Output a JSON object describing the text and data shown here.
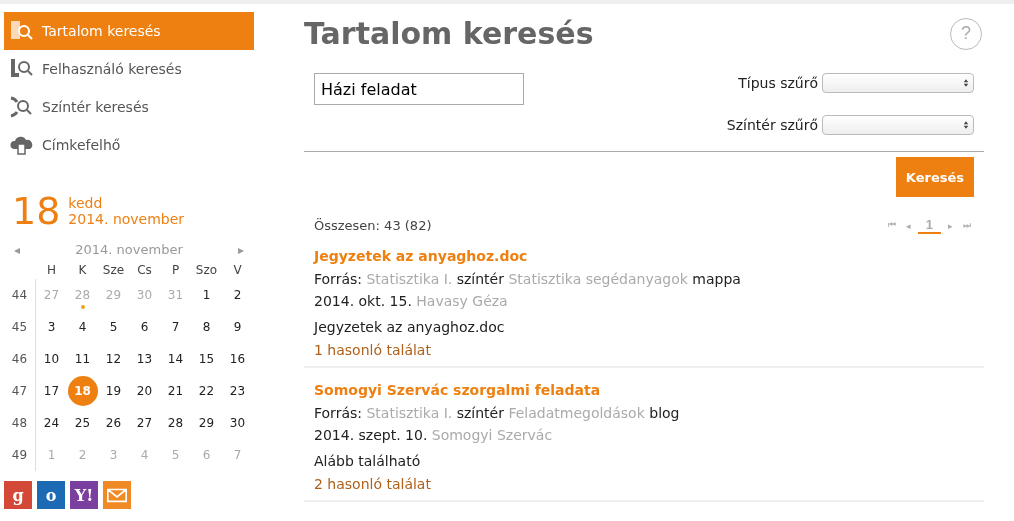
{
  "nav": [
    {
      "label": "Tartalom keresés",
      "kind": "content",
      "selected": true
    },
    {
      "label": "Felhasználó keresés",
      "kind": "user",
      "selected": false
    },
    {
      "label": "Színtér keresés",
      "kind": "scene",
      "selected": false
    },
    {
      "label": "Címkefelhő",
      "kind": "cloud",
      "selected": false
    }
  ],
  "today": {
    "day": "18",
    "weekday": "kedd",
    "month": "2014. november"
  },
  "calendar": {
    "prev": "◂",
    "next": "▸",
    "title": "2014. november",
    "weekdays": [
      "H",
      "K",
      "Sze",
      "Cs",
      "P",
      "Szo",
      "V"
    ],
    "weeks": [
      {
        "week": "44",
        "days": [
          {
            "d": "27",
            "muted": true,
            "selected": false,
            "event": false
          },
          {
            "d": "28",
            "muted": true,
            "selected": false,
            "event": true
          },
          {
            "d": "29",
            "muted": true,
            "selected": false,
            "event": false
          },
          {
            "d": "30",
            "muted": true,
            "selected": false,
            "event": false
          },
          {
            "d": "31",
            "muted": true,
            "selected": false,
            "event": false
          },
          {
            "d": "1",
            "muted": false,
            "selected": false,
            "event": false
          },
          {
            "d": "2",
            "muted": false,
            "selected": false,
            "event": false
          }
        ]
      },
      {
        "week": "45",
        "days": [
          {
            "d": "3",
            "muted": false,
            "selected": false,
            "event": false
          },
          {
            "d": "4",
            "muted": false,
            "selected": false,
            "event": false
          },
          {
            "d": "5",
            "muted": false,
            "selected": false,
            "event": false
          },
          {
            "d": "6",
            "muted": false,
            "selected": false,
            "event": false
          },
          {
            "d": "7",
            "muted": false,
            "selected": false,
            "event": false
          },
          {
            "d": "8",
            "muted": false,
            "selected": false,
            "event": false
          },
          {
            "d": "9",
            "muted": false,
            "selected": false,
            "event": false
          }
        ]
      },
      {
        "week": "46",
        "days": [
          {
            "d": "10",
            "muted": false,
            "selected": false,
            "event": false
          },
          {
            "d": "11",
            "muted": false,
            "selected": false,
            "event": false
          },
          {
            "d": "12",
            "muted": false,
            "selected": false,
            "event": false
          },
          {
            "d": "13",
            "muted": false,
            "selected": false,
            "event": false
          },
          {
            "d": "14",
            "muted": false,
            "selected": false,
            "event": false
          },
          {
            "d": "15",
            "muted": false,
            "selected": false,
            "event": false
          },
          {
            "d": "16",
            "muted": false,
            "selected": false,
            "event": false
          }
        ]
      },
      {
        "week": "47",
        "days": [
          {
            "d": "17",
            "muted": false,
            "selected": false,
            "event": false
          },
          {
            "d": "18",
            "muted": false,
            "selected": true,
            "event": false
          },
          {
            "d": "19",
            "muted": false,
            "selected": false,
            "event": false
          },
          {
            "d": "20",
            "muted": false,
            "selected": false,
            "event": false
          },
          {
            "d": "21",
            "muted": false,
            "selected": false,
            "event": false
          },
          {
            "d": "22",
            "muted": false,
            "selected": false,
            "event": false
          },
          {
            "d": "23",
            "muted": false,
            "selected": false,
            "event": false
          }
        ]
      },
      {
        "week": "48",
        "days": [
          {
            "d": "24",
            "muted": false,
            "selected": false,
            "event": false
          },
          {
            "d": "25",
            "muted": false,
            "selected": false,
            "event": false
          },
          {
            "d": "26",
            "muted": false,
            "selected": false,
            "event": false
          },
          {
            "d": "27",
            "muted": false,
            "selected": false,
            "event": false
          },
          {
            "d": "28",
            "muted": false,
            "selected": false,
            "event": false
          },
          {
            "d": "29",
            "muted": false,
            "selected": false,
            "event": false
          },
          {
            "d": "30",
            "muted": false,
            "selected": false,
            "event": false
          }
        ]
      },
      {
        "week": "49",
        "days": [
          {
            "d": "1",
            "muted": true,
            "selected": false,
            "event": false
          },
          {
            "d": "2",
            "muted": true,
            "selected": false,
            "event": false
          },
          {
            "d": "3",
            "muted": true,
            "selected": false,
            "event": false
          },
          {
            "d": "4",
            "muted": true,
            "selected": false,
            "event": false
          },
          {
            "d": "5",
            "muted": true,
            "selected": false,
            "event": false
          },
          {
            "d": "6",
            "muted": true,
            "selected": false,
            "event": false
          },
          {
            "d": "7",
            "muted": true,
            "selected": false,
            "event": false
          }
        ]
      }
    ]
  },
  "services": [
    {
      "mark": "g",
      "color": "#d34836"
    },
    {
      "mark": "o",
      "color": "#1c6ab4"
    },
    {
      "mark": "Y!",
      "color": "#7b3fa0"
    },
    {
      "color": "#f08a24"
    }
  ],
  "title": "Tartalom keresés",
  "help": "?",
  "search": {
    "value": "Házi feladat"
  },
  "filters": [
    {
      "label": "Típus szűrő"
    },
    {
      "label": "Színtér szűrő"
    }
  ],
  "search_button": "Keresés",
  "total": "Összesen: 43 (82)",
  "pager": {
    "first": "⏮",
    "prev": "◂",
    "page": "1",
    "next": "▸",
    "last": "⏭"
  },
  "results": [
    {
      "title": "Jegyzetek az anyaghoz.doc",
      "source_label": "Forrás:",
      "space": "Statisztika I.",
      "space_word": "színtér",
      "container": "Statisztika segédanyagok",
      "container_word": "mappa",
      "date": "2014. okt. 15.",
      "author": "Havasy Géza",
      "excerpt": "Jegyzetek az anyaghoz.doc",
      "similar": "1 hasonló találat"
    },
    {
      "title": "Somogyi Szervác szorgalmi feladata",
      "source_label": "Forrás:",
      "space": "Statisztika I.",
      "space_word": "színtér",
      "container": "Feladatmegoldások",
      "container_word": "blog",
      "date": "2014. szept. 10.",
      "author": "Somogyi Szervác",
      "excerpt": "Alább található",
      "similar": "2 hasonló találat"
    }
  ]
}
